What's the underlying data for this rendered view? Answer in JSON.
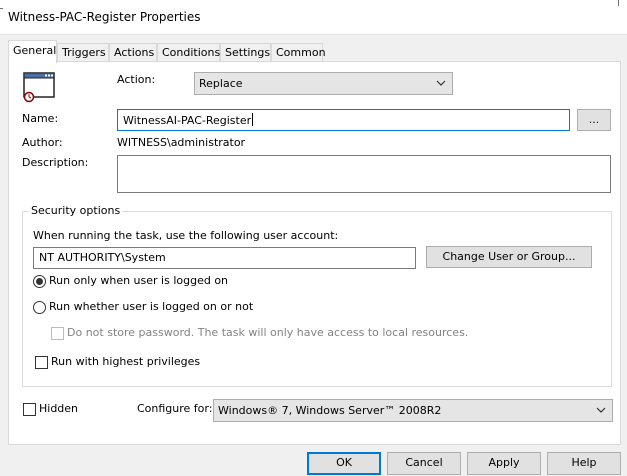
{
  "window": {
    "title": "Witness-PAC-Register Properties"
  },
  "tabs": [
    {
      "label": "General"
    },
    {
      "label": "Triggers"
    },
    {
      "label": "Actions"
    },
    {
      "label": "Conditions"
    },
    {
      "label": "Settings"
    },
    {
      "label": "Common"
    }
  ],
  "general": {
    "action_label": "Action:",
    "action_value": "Replace",
    "name_label": "Name:",
    "name_value": "WitnessAI-PAC-Register",
    "browse_label": "...",
    "author_label": "Author:",
    "author_value": "WITNESS\\administrator",
    "description_label": "Description:",
    "description_value": ""
  },
  "security": {
    "legend": "Security options",
    "prompt": "When running the task, use the following user account:",
    "user_account": "NT AUTHORITY\\System",
    "change_user_label": "Change User or Group...",
    "run_logged_on_label": "Run only when user is logged on",
    "run_logged_on_selected": true,
    "run_whether_label": "Run whether user is logged on or not",
    "run_whether_selected": false,
    "no_store_password_label": "Do not store password.  The task will only have access to local resources.",
    "highest_privileges_label": "Run with highest privileges"
  },
  "bottom": {
    "hidden_label": "Hidden",
    "configure_label": "Configure for:",
    "configure_value": "Windows® 7, Windows Server™ 2008R2"
  },
  "buttons": {
    "ok": "OK",
    "cancel": "Cancel",
    "apply": "Apply",
    "help": "Help"
  },
  "colors": {
    "focus_accent": "#0078d7",
    "button_face": "#e1e1e1",
    "window_bg": "#f0f0f0"
  }
}
